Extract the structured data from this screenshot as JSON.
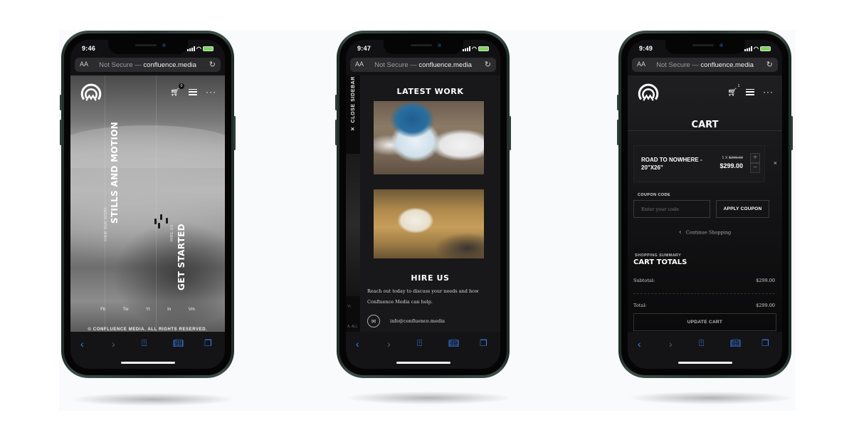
{
  "browser": {
    "aa_label": "AA",
    "url_prefix": "Not Secure — ",
    "url_domain": "confluence.media"
  },
  "phones": [
    {
      "status_time": "9:46",
      "screen": "home",
      "cart_count": "0",
      "hero": {
        "headline": "STILLS AND MOTION",
        "headline_link": "VIEW OUR WORK",
        "cta": "GET STARTED",
        "cta_link": "HIRE US"
      },
      "social_links": [
        "Fb",
        "Tw",
        "Yt",
        "In",
        "Vm"
      ],
      "copyright": "© CONFLUENCE MEDIA. ALL RIGHTS RESERVED."
    },
    {
      "status_time": "9:47",
      "screen": "sidebar",
      "close_sidebar_label": "CLOSE SIDEBAR",
      "peek_texts": [
        "Yt",
        "A. ALL"
      ],
      "latest_work_title": "LATEST WORK",
      "gallery": [
        {
          "alt": "Aerial view of a partially frozen alpine lake surrounded by snow"
        },
        {
          "alt": "White puppy running through golden grass"
        }
      ],
      "hire_title": "HIRE US",
      "hire_text": "Reach out today to discuss your needs and how Confluence Media can help.",
      "contact_email": "info@confluence.media"
    },
    {
      "status_time": "9:49",
      "screen": "cart",
      "cart_count": "1",
      "page_title": "CART",
      "item": {
        "name": "ROAD TO NOWHERE - 20\"X26\"",
        "qty_prefix": "1 X ",
        "unit_price": "$299.00",
        "line_total": "$299.00",
        "plus": "+",
        "minus": "−",
        "remove": "×"
      },
      "coupon": {
        "label": "COUPON CODE",
        "placeholder": "Enter your code",
        "button": "APPLY COUPON"
      },
      "continue_shopping": "Continue Shopping",
      "summary": {
        "eyebrow": "SHOPPING SUMMARY",
        "title": "CART TOTALS",
        "subtotal_label": "Subtotal:",
        "subtotal_value": "$299.00",
        "total_label": "Total:",
        "total_value": "$299.00",
        "update_button": "UPDATE CART"
      }
    }
  ],
  "toolbar": {
    "back": "‹",
    "forward": "›"
  },
  "colors": {
    "safari_blue": "#3b82f6",
    "phone_frame": "#2e3c36",
    "page_bg": "#f8fafc"
  }
}
